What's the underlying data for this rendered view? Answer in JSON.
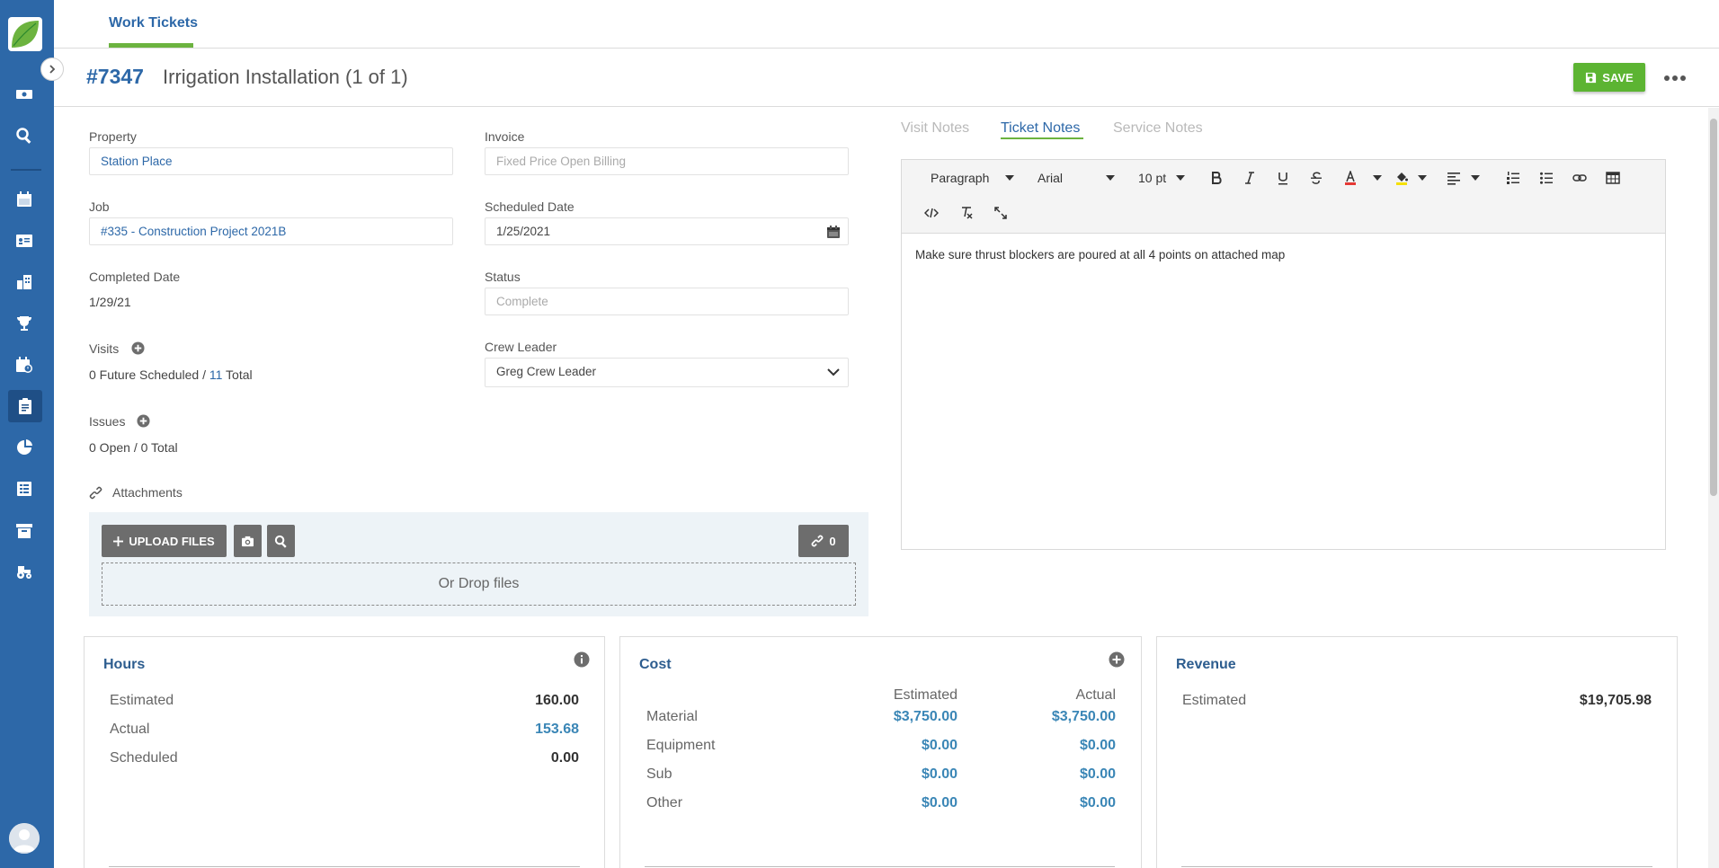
{
  "colors": {
    "sidebar": "#2d68a8",
    "accent_green": "#6cb33f",
    "link_blue": "#2d68a8",
    "value_blue": "#3a86b6"
  },
  "sidebar": {
    "icons": [
      "money-icon",
      "search-icon",
      "calendar-icon",
      "contacts-icon",
      "buildings-icon",
      "trophy-icon",
      "schedule-icon",
      "clipboard-icon",
      "pie-chart-icon",
      "report-icon",
      "archive-icon",
      "tractor-icon"
    ]
  },
  "topbar": {
    "tab_label": "Work Tickets"
  },
  "header": {
    "ticket_number": "#7347",
    "ticket_title": "Irrigation Installation (1 of 1)",
    "save_label": "SAVE"
  },
  "form": {
    "property_label": "Property",
    "property_value": "Station Place",
    "invoice_label": "Invoice",
    "invoice_placeholder": "Fixed Price Open Billing",
    "job_label": "Job",
    "job_value": "#335 - Construction Project 2021B",
    "scheduled_label": "Scheduled Date",
    "scheduled_value": "1/25/2021",
    "completed_label": "Completed Date",
    "completed_value": "1/29/21",
    "status_label": "Status",
    "status_placeholder": "Complete",
    "visits_label": "Visits",
    "visits_prefix": "0 Future Scheduled / ",
    "visits_count": "11",
    "visits_suffix": " Total",
    "crew_label": "Crew Leader",
    "crew_value": "Greg Crew Leader",
    "issues_label": "Issues",
    "issues_value": "0 Open / 0 Total",
    "attachments_label": "Attachments"
  },
  "attachments": {
    "upload_label": "UPLOAD FILES",
    "link_count": "0",
    "drop_text": "Or Drop files"
  },
  "notes": {
    "tabs": [
      "Visit Notes",
      "Ticket Notes",
      "Service Notes"
    ],
    "active_tab": "Ticket Notes",
    "toolbar": {
      "block_format": "Paragraph",
      "font": "Arial",
      "font_size": "10 pt",
      "text_color": "#e53935",
      "highlight_color": "#f5e000"
    },
    "content": "Make sure thrust blockers are poured at all 4 points on attached map"
  },
  "hours": {
    "title": "Hours",
    "rows": [
      {
        "label": "Estimated",
        "value": "160.00",
        "blue": false
      },
      {
        "label": "Actual",
        "value": "153.68",
        "blue": true
      },
      {
        "label": "Scheduled",
        "value": "0.00",
        "blue": false
      }
    ]
  },
  "cost": {
    "title": "Cost",
    "col_estimated": "Estimated",
    "col_actual": "Actual",
    "rows": [
      {
        "label": "Material",
        "estimated": "$3,750.00",
        "actual": "$3,750.00"
      },
      {
        "label": "Equipment",
        "estimated": "$0.00",
        "actual": "$0.00"
      },
      {
        "label": "Sub",
        "estimated": "$0.00",
        "actual": "$0.00"
      },
      {
        "label": "Other",
        "estimated": "$0.00",
        "actual": "$0.00"
      }
    ]
  },
  "revenue": {
    "title": "Revenue",
    "rows": [
      {
        "label": "Estimated",
        "value": "$19,705.98"
      }
    ]
  }
}
